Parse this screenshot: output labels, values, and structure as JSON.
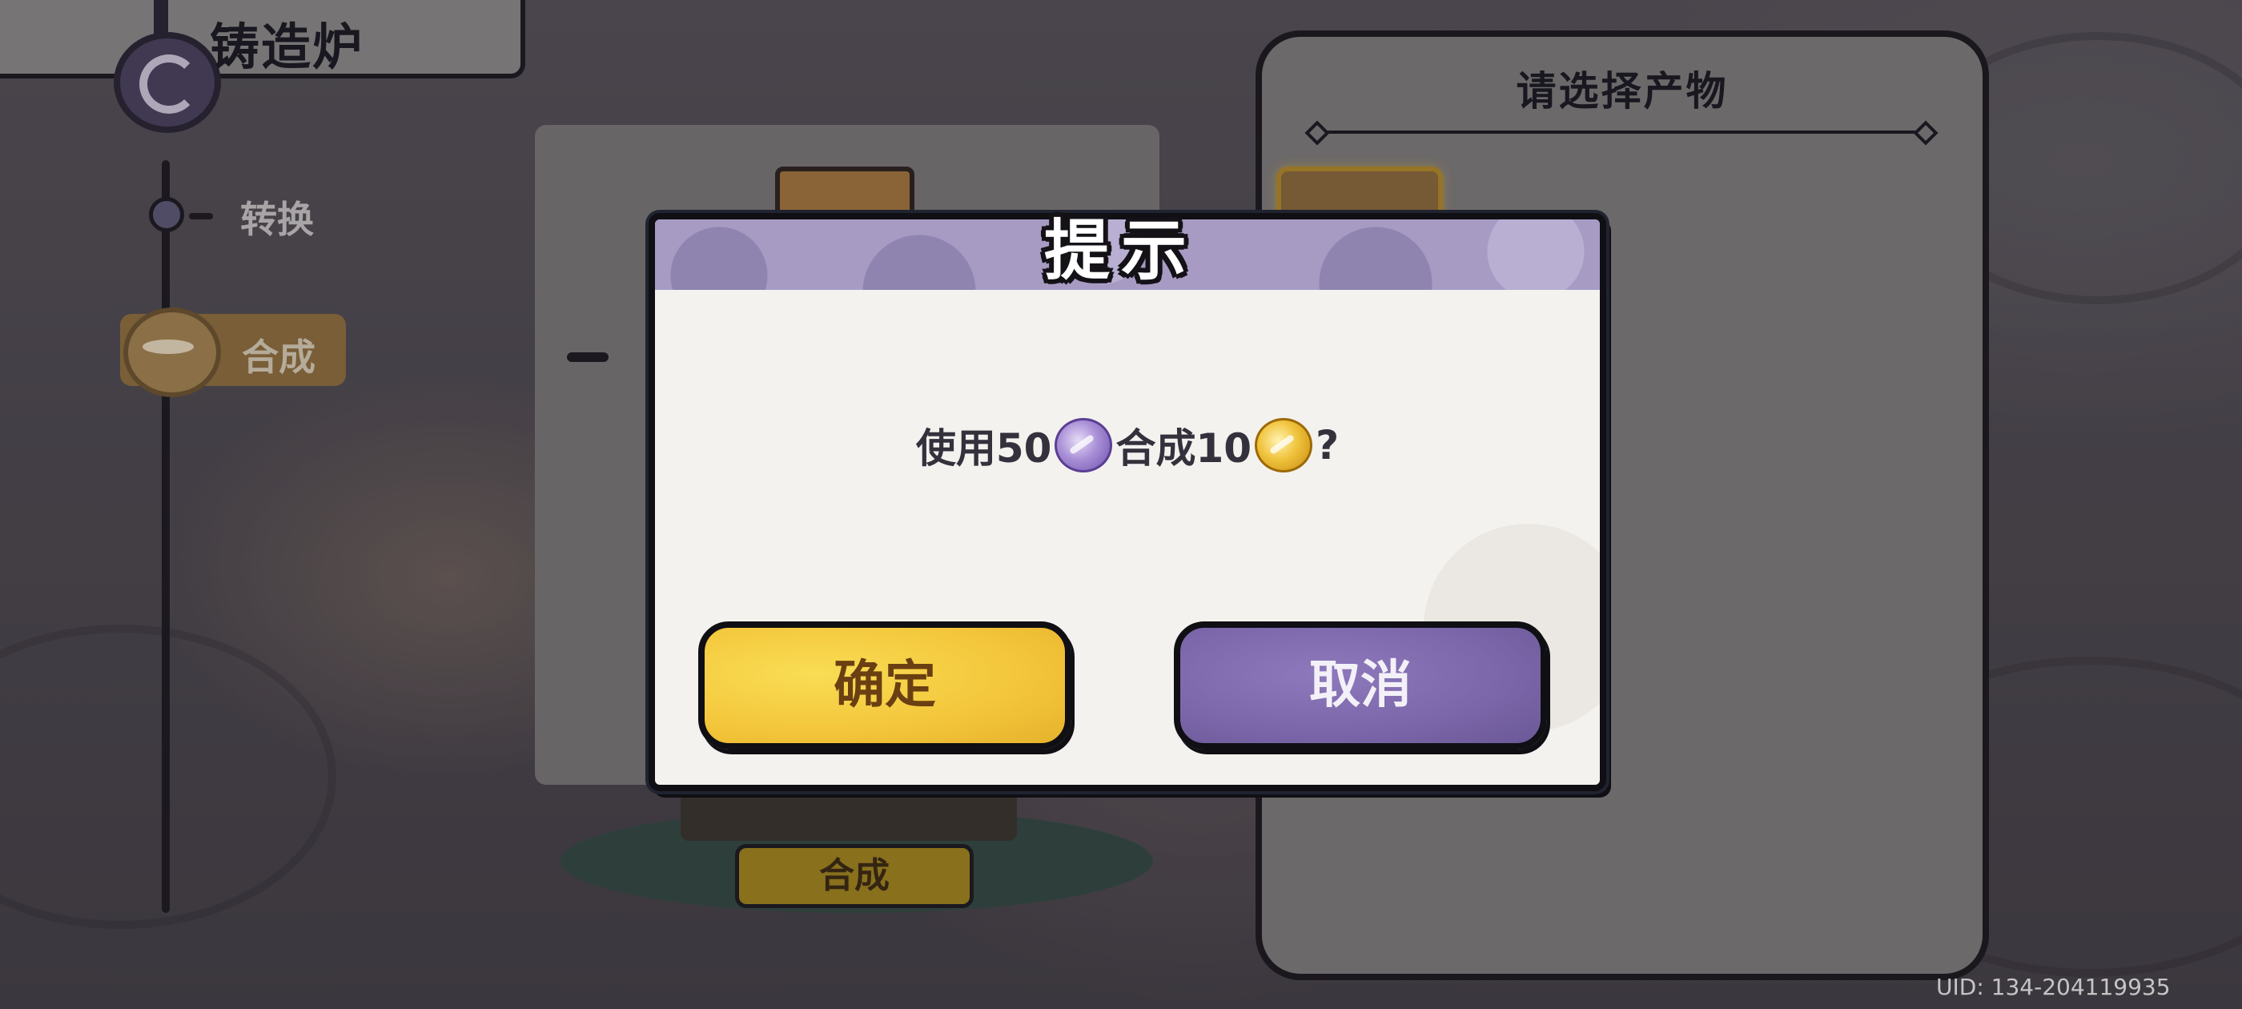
{
  "header": {
    "title": "铸造炉"
  },
  "sidebar": {
    "items": [
      {
        "label": "转换",
        "active": false
      },
      {
        "label": "合成",
        "active": true
      }
    ]
  },
  "center": {
    "synth_button_label": "合成"
  },
  "right_panel": {
    "title": "请选择产物"
  },
  "dialog": {
    "title": "提示",
    "message_prefix": "使用50",
    "message_middle": "合成10",
    "message_suffix": "?",
    "cost_icon": "purple-gem-icon",
    "reward_icon": "gold-gem-icon",
    "confirm_label": "确定",
    "cancel_label": "取消"
  },
  "footer": {
    "uid": "UID:  134-204119935"
  },
  "colors": {
    "confirm": "#f3c53a",
    "cancel": "#7a66a8",
    "dialog_header": "#a79bc4"
  }
}
